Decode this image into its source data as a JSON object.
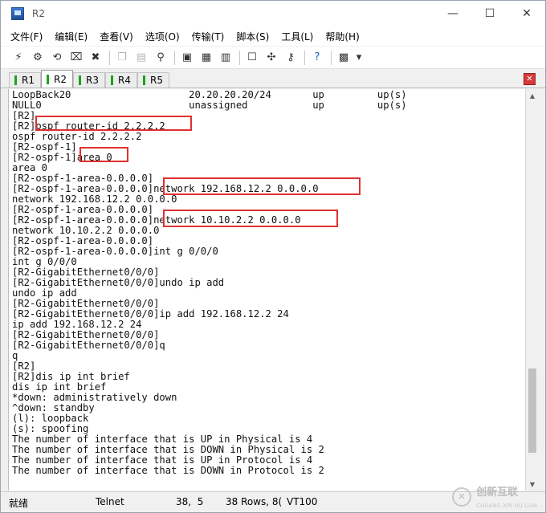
{
  "window": {
    "title": "R2"
  },
  "title_controls": {
    "minimize": "—",
    "maximize": "☐",
    "close": "✕"
  },
  "menu": [
    "文件(F)",
    "编辑(E)",
    "查看(V)",
    "选项(O)",
    "传输(T)",
    "脚本(S)",
    "工具(L)",
    "帮助(H)"
  ],
  "toolbar_icons": [
    "connect-icon",
    "quick-connect-icon",
    "reconnect-icon",
    "disconnect-icon",
    "close-session-icon",
    "copy-icon",
    "paste-icon",
    "find-icon",
    "print-icon",
    "print-setup-icon",
    "print-screen-icon",
    "session-options-icon",
    "global-options-icon",
    "key-icon",
    "help-icon",
    "keymap-icon",
    "more-icon"
  ],
  "tabs": [
    {
      "label": "R1",
      "active": false
    },
    {
      "label": "R2",
      "active": true
    },
    {
      "label": "R3",
      "active": false
    },
    {
      "label": "R4",
      "active": false
    },
    {
      "label": "R5",
      "active": false
    }
  ],
  "terminal_lines": [
    "LoopBack20                    20.20.20.20/24       up         up(s)",
    "NULL0                         unassigned           up         up(s)",
    "[R2]",
    "[R2]ospf router-id 2.2.2.2",
    "ospf router-id 2.2.2.2",
    "[R2-ospf-1]",
    "[R2-ospf-1]area 0",
    "area 0",
    "[R2-ospf-1-area-0.0.0.0]",
    "[R2-ospf-1-area-0.0.0.0]network 192.168.12.2 0.0.0.0",
    "network 192.168.12.2 0.0.0.0",
    "[R2-ospf-1-area-0.0.0.0]",
    "[R2-ospf-1-area-0.0.0.0]network 10.10.2.2 0.0.0.0",
    "network 10.10.2.2 0.0.0.0",
    "[R2-ospf-1-area-0.0.0.0]",
    "[R2-ospf-1-area-0.0.0.0]int g 0/0/0",
    "int g 0/0/0",
    "[R2-GigabitEthernet0/0/0]",
    "[R2-GigabitEthernet0/0/0]undo ip add",
    "undo ip add",
    "[R2-GigabitEthernet0/0/0]",
    "[R2-GigabitEthernet0/0/0]ip add 192.168.12.2 24",
    "ip add 192.168.12.2 24",
    "[R2-GigabitEthernet0/0/0]",
    "[R2-GigabitEthernet0/0/0]q",
    "q",
    "[R2]",
    "[R2]dis ip int brief",
    "dis ip int brief",
    "*down: administratively down",
    "^down: standby",
    "(l): loopback",
    "(s): spoofing",
    "The number of interface that is UP in Physical is 4",
    "The number of interface that is DOWN in Physical is 2",
    "The number of interface that is UP in Protocol is 4",
    "The number of interface that is DOWN in Protocol is 2"
  ],
  "status": {
    "ready": "就绪",
    "protocol": "Telnet",
    "cursor": "38,  5",
    "size": "38 Rows, 8(",
    "emulation": "VT100"
  },
  "colors": {
    "highlight": "#e03030",
    "tab_marker": "#1ba31b",
    "close_tab": "#d63b3b"
  }
}
